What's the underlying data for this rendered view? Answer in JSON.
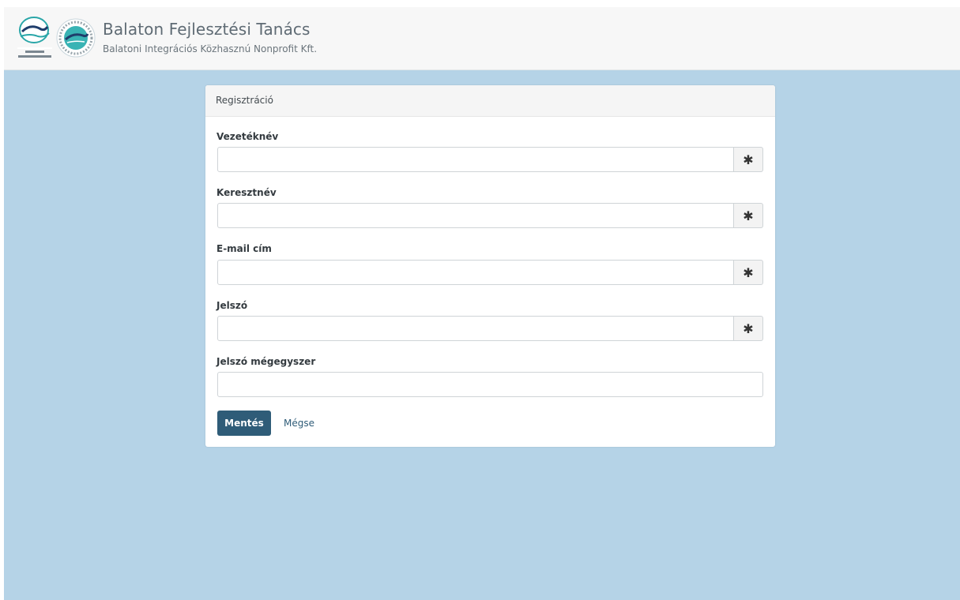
{
  "header": {
    "title": "Balaton Fejlesztési Tanács",
    "subtitle": "Balatoni Integrációs Közhasznú Nonprofit Kft.",
    "logo1_text": "Balaton Fejlesztési Tanács",
    "logo2_text": "Balatoni Integrációs Közhasznú Nonprofit Kft."
  },
  "form": {
    "title": "Regisztráció",
    "fields": [
      {
        "label": "Vezetéknév",
        "value": "",
        "required_marker": "✱"
      },
      {
        "label": "Keresztnév",
        "value": "",
        "required_marker": "✱"
      },
      {
        "label": "E-mail cím",
        "value": "",
        "required_marker": "✱"
      },
      {
        "label": "Jelszó",
        "value": "",
        "required_marker": "✱"
      },
      {
        "label": "Jelszó mégegyszer",
        "value": ""
      }
    ],
    "save_label": "Mentés",
    "cancel_label": "Mégse"
  },
  "colors": {
    "page_background": "#b5d3e7",
    "primary_button": "#2f5c78",
    "header_background": "#f7f7f7"
  }
}
